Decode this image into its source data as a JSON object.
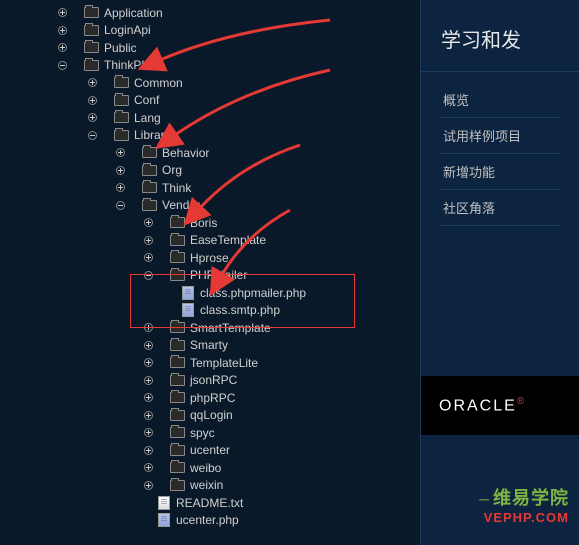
{
  "tree": {
    "n0": "Application",
    "n1": "LoginApi",
    "n2": "Public",
    "n3": "ThinkPHP",
    "n4": "Common",
    "n5": "Conf",
    "n6": "Lang",
    "n7": "Library",
    "n8": "Behavior",
    "n9": "Org",
    "n10": "Think",
    "n11": "Vendor",
    "n12": "Boris",
    "n13": "EaseTemplate",
    "n14": "Hprose",
    "n15": "PHPMailer",
    "n16": "class.phpmailer.php",
    "n17": "class.smtp.php",
    "n18": "SmartTemplate",
    "n19": "Smarty",
    "n20": "TemplateLite",
    "n21": "jsonRPC",
    "n22": "phpRPC",
    "n23": "qqLogin",
    "n24": "spyc",
    "n25": "ucenter",
    "n26": "weibo",
    "n27": "weixin",
    "n28": "README.txt",
    "n29": "ucenter.php"
  },
  "right": {
    "header": "学习和发",
    "l0": "概览",
    "l1": "试用样例项目",
    "l2": "新增功能",
    "l3": "社区角落"
  },
  "oracle": "ORACLE",
  "watermark": {
    "line1a": "维易",
    "line1b": "学院",
    "line2": "VEPHP.COM"
  }
}
